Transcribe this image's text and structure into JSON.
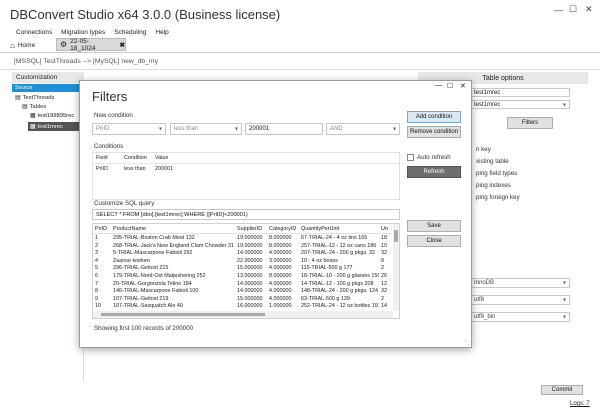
{
  "app": {
    "title": "DBConvert Studio x64 3.0.0 (Business license)"
  },
  "menu": [
    "Connections",
    "Migration types",
    "Scheduling",
    "Help"
  ],
  "tabs": {
    "home": "Home",
    "session": "22-05-18_1024"
  },
  "breadcrumb": "[MSSQL] TestThreads --> [MySQL] new_db_my",
  "left_panel": {
    "header": "Customization",
    "source_label": "Source",
    "tree": {
      "db": "TestThreads",
      "tables": "Tables",
      "items": [
        "test199895rec",
        "test1mrec"
      ]
    }
  },
  "right_panel": {
    "header": "Table options",
    "field_value": "test1mrec",
    "dropdown_value": "test1mrec",
    "filters_button": "Filters",
    "options": [
      "n key",
      "xisting table",
      "ping field types",
      "ping indexes",
      "ping foreign key"
    ],
    "engine": "InnoDB",
    "charset": "utf8",
    "collation": "utf8_bin"
  },
  "footer": {
    "commit": "Commit",
    "logs": "Logs: 7"
  },
  "dialog": {
    "title": "Filters",
    "new_condition": {
      "label": "New condition",
      "field_placeholder": "PriID",
      "operator_placeholder": "less than",
      "value": "200001",
      "logic": "AND"
    },
    "buttons": {
      "add": "Add condition",
      "remove": "Remove condition",
      "refresh": "Refresh",
      "save": "Save",
      "close": "Close"
    },
    "auto_refresh": "Auto refresh",
    "conditions": {
      "label": "Conditions",
      "headers": [
        "Field",
        "Condition",
        "Value"
      ],
      "rows": [
        [
          "PriID",
          "less than",
          "200001"
        ]
      ]
    },
    "sql": {
      "label": "Customize SQL query",
      "query": "SELECT * FROM [dbo].[test1mrec] WHERE ([PriID]<200001)"
    },
    "grid": {
      "headers": [
        "PriID",
        "ProductName",
        "SupplierID",
        "CategoryID",
        "QuantityPerUnit",
        "Un"
      ],
      "rows": [
        [
          "1",
          "295-TRIAL-Boston Crab Meat 132",
          "19.000000",
          "8.000000",
          "67-TRIAL-24 - 4 oz tins 165",
          "18"
        ],
        [
          "2",
          "268-TRIAL-Jack's New England Clam Chowder 31",
          "19.000000",
          "8.000000",
          "257-TRIAL-12 - 12 oz cans 186",
          "10"
        ],
        [
          "3",
          "5-TRIAL-Mascarpone Fabioli 292",
          "14.000000",
          "4.000000",
          "207-TRIAL-24 - 200 g pkgs. 32",
          "32"
        ],
        [
          "4",
          "Zaanse koeken",
          "22.000000",
          "3.000000",
          "10 - 4 oz boxes",
          "9"
        ],
        [
          "5",
          "296-TRIAL-Geitost 215",
          "15.000000",
          "4.000000",
          "115-TRIAL-500 g 177",
          "2"
        ],
        [
          "6",
          "179-TRIAL-Nord-Ost Matjeshering 252",
          "13.000000",
          "8.000000",
          "18-TRIAL-10 - 200 g glasses 156",
          "26"
        ],
        [
          "7",
          "20-TRIAL-Gorgonzola Telino 184",
          "14.000000",
          "4.000000",
          "14-TRIAL-12 - 100 g pkgs 208",
          "12"
        ],
        [
          "8",
          "146-TRIAL-Mascarpone Fabioli 100",
          "14.000000",
          "4.000000",
          "148-TRIAL-24 - 200 g pkgs. 124",
          "32"
        ],
        [
          "9",
          "107-TRIAL-Geitost 219",
          "15.000000",
          "4.000000",
          "63-TRIAL-500 g 139",
          "2"
        ],
        [
          "10",
          "197-TRIAL-Sasquatch Ale 40",
          "16.000000",
          "1.000000",
          "252-TRIAL-24 - 12 oz bottles 197",
          "14"
        ]
      ]
    },
    "status": "Showing first 100 records   of 200000"
  }
}
